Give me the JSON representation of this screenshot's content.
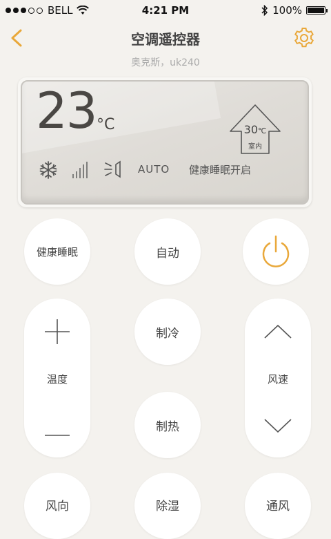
{
  "status_bar": {
    "carrier": "BELL",
    "time": "4:21 PM",
    "battery": "100%"
  },
  "nav": {
    "title": "空调遥控器",
    "subtitle": "奥克斯，uk240"
  },
  "display": {
    "set_temp": "23",
    "set_unit": "°C",
    "indoor_temp": "30",
    "indoor_unit": "℃",
    "indoor_label": "室内",
    "fan_mode": "AUTO",
    "sleep_status": "健康睡眠开启"
  },
  "buttons": {
    "healthy_sleep": "健康睡眠",
    "auto": "自动",
    "cool": "制冷",
    "heat": "制热",
    "temp_label": "温度",
    "fan_speed_label": "风速",
    "direction": "风向",
    "dehumidify": "除湿",
    "ventilate": "通风"
  },
  "colors": {
    "accent": "#e9a83a",
    "background": "#f4f2ee"
  }
}
